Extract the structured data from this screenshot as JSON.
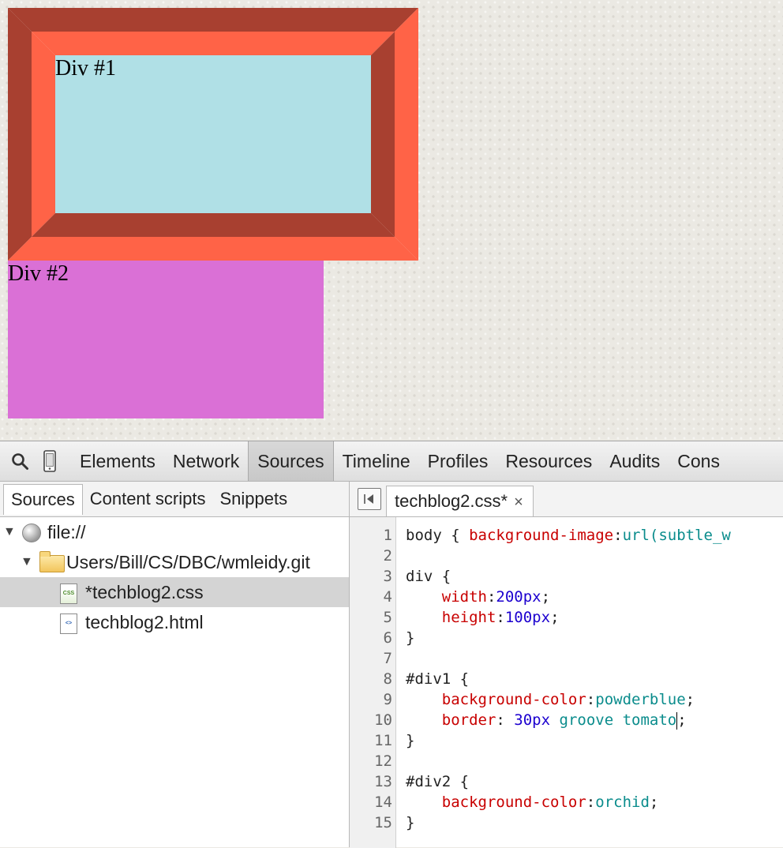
{
  "page": {
    "div1_label": "Div #1",
    "div2_label": "Div #2"
  },
  "devtools": {
    "toolbar": {
      "tabs": [
        "Elements",
        "Network",
        "Sources",
        "Timeline",
        "Profiles",
        "Resources",
        "Audits",
        "Cons"
      ],
      "selected": "Sources",
      "icons": [
        "search-icon",
        "device-mode-icon"
      ]
    },
    "navigator": {
      "tabs": [
        "Sources",
        "Content scripts",
        "Snippets"
      ],
      "selected": "Sources",
      "tree": {
        "root": "file://",
        "folder": "Users/Bill/CS/DBC/wmleidy.git",
        "files": [
          {
            "name": "*techblog2.css",
            "icon": "css-file-icon",
            "selected": true
          },
          {
            "name": "techblog2.html",
            "icon": "html-file-icon",
            "selected": false
          }
        ]
      }
    },
    "editor": {
      "tab_title": "techblog2.css*",
      "close_glyph": "×",
      "line_numbers": [
        "1",
        "2",
        "3",
        "4",
        "5",
        "6",
        "7",
        "8",
        "9",
        "10",
        "11",
        "12",
        "13",
        "14",
        "15"
      ],
      "lines": [
        [
          {
            "t": "body { ",
            "c": ""
          },
          {
            "t": "background-image",
            "c": "prop"
          },
          {
            "t": ":",
            "c": ""
          },
          {
            "t": "url(subtle_w",
            "c": "val"
          }
        ],
        [],
        [
          {
            "t": "div {",
            "c": ""
          }
        ],
        [
          {
            "t": "    ",
            "c": ""
          },
          {
            "t": "width",
            "c": "prop"
          },
          {
            "t": ":",
            "c": ""
          },
          {
            "t": "200px",
            "c": "num"
          },
          {
            "t": ";",
            "c": ""
          }
        ],
        [
          {
            "t": "    ",
            "c": ""
          },
          {
            "t": "height",
            "c": "prop"
          },
          {
            "t": ":",
            "c": ""
          },
          {
            "t": "100px",
            "c": "num"
          },
          {
            "t": ";",
            "c": ""
          }
        ],
        [
          {
            "t": "}",
            "c": ""
          }
        ],
        [],
        [
          {
            "t": "#div1 {",
            "c": ""
          }
        ],
        [
          {
            "t": "    ",
            "c": ""
          },
          {
            "t": "background-color",
            "c": "prop"
          },
          {
            "t": ":",
            "c": ""
          },
          {
            "t": "powderblue",
            "c": "val"
          },
          {
            "t": ";",
            "c": ""
          }
        ],
        [
          {
            "t": "    ",
            "c": ""
          },
          {
            "t": "border",
            "c": "prop"
          },
          {
            "t": ": ",
            "c": ""
          },
          {
            "t": "30px",
            "c": "num"
          },
          {
            "t": " ",
            "c": ""
          },
          {
            "t": "groove tomato",
            "c": "val"
          },
          {
            "t": "|",
            "c": "caret"
          },
          {
            "t": ";",
            "c": ""
          }
        ],
        [
          {
            "t": "}",
            "c": ""
          }
        ],
        [],
        [
          {
            "t": "#div2 {",
            "c": ""
          }
        ],
        [
          {
            "t": "    ",
            "c": ""
          },
          {
            "t": "background-color",
            "c": "prop"
          },
          {
            "t": ":",
            "c": ""
          },
          {
            "t": "orchid",
            "c": "val"
          },
          {
            "t": ";",
            "c": ""
          }
        ],
        [
          {
            "t": "}",
            "c": ""
          }
        ]
      ]
    },
    "colors": {
      "tomato": "#ff6347",
      "tomato_dark": "#a84030",
      "powderblue": "#b0e0e6",
      "orchid": "#da70d6"
    }
  }
}
